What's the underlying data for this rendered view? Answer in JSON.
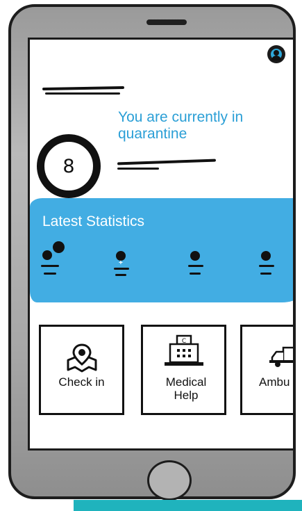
{
  "header": {
    "status_text": "You are currently in quarantine",
    "counter_value": "8"
  },
  "stats": {
    "title": "Latest Statistics"
  },
  "actions": [
    {
      "label": "Check in",
      "icon": "map-pin-icon"
    },
    {
      "label": "Medical Help",
      "icon": "hospital-icon"
    },
    {
      "label": "Ambu",
      "icon": "ambulance-icon"
    }
  ],
  "colors": {
    "accent": "#42ade3",
    "text_accent": "#2b9fd6",
    "teal": "#1fb3bd"
  }
}
